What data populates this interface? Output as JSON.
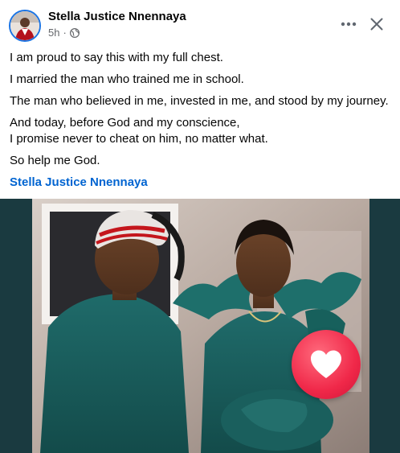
{
  "post": {
    "author": "Stella Justice Nnennaya",
    "time": "5h",
    "separator": "·",
    "privacy_icon": "globe-icon",
    "more_icon": "more-horizontal-icon",
    "close_icon": "close-icon",
    "lines": {
      "p1": "I am proud to say this with my full chest.",
      "p2": "I married the man who trained me in school.",
      "p3": "The man who believed in me, invested in me, and stood by my journey.",
      "p4": "And today, before God and my conscience,",
      "p5": "I promise never to cheat on him, no matter what.",
      "p6": "So help me God."
    },
    "tag": "Stella Justice Nnennaya"
  },
  "reaction": {
    "icon": "heart-icon",
    "color": "#f02849"
  },
  "colors": {
    "link": "#0064d1",
    "secondary_text": "#65676b",
    "photo_bg": "#1a3a40"
  }
}
